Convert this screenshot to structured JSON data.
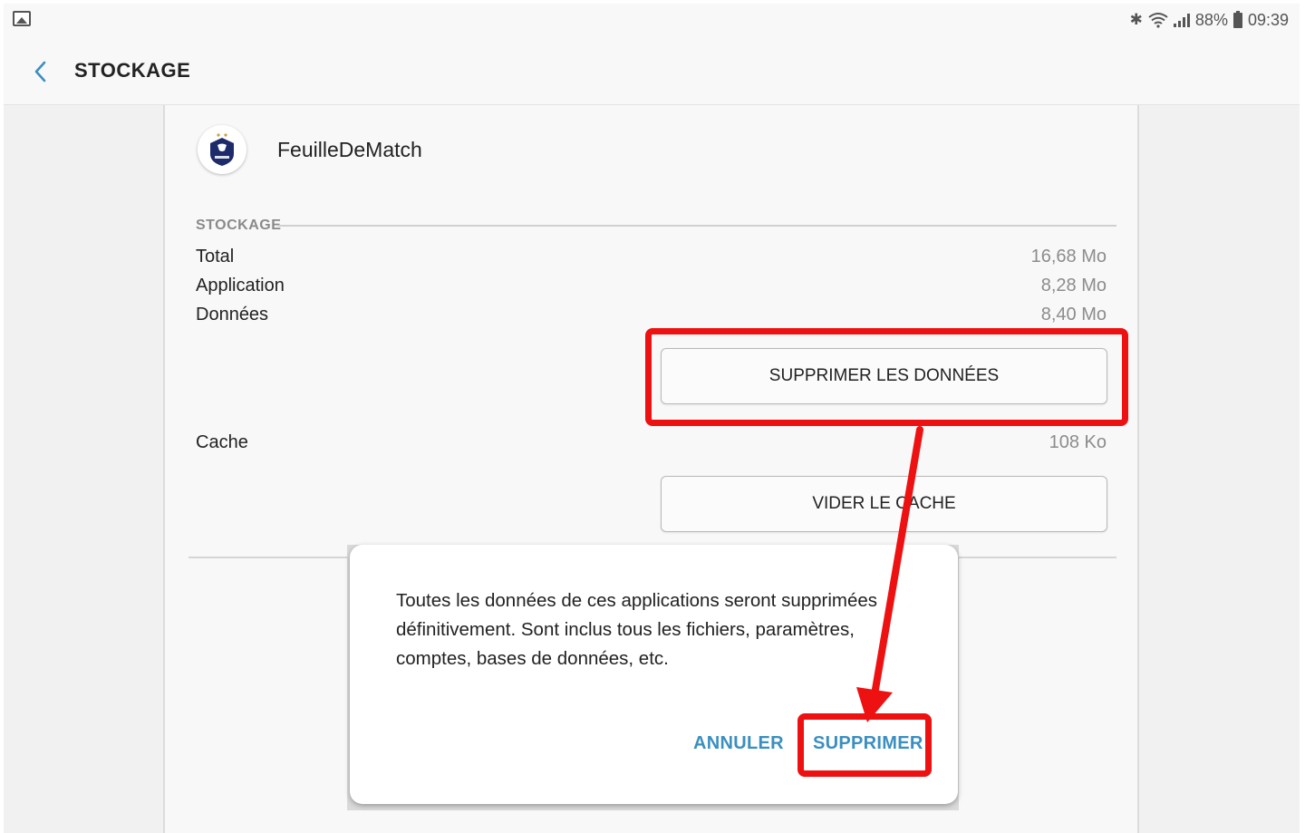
{
  "status_bar": {
    "battery": "88%",
    "time": "09:39",
    "icons": [
      "gallery-icon",
      "bluetooth-icon",
      "wifi-icon",
      "signal-icon",
      "battery-icon"
    ]
  },
  "app_bar": {
    "title": "STOCKAGE",
    "back_icon": "chevron-left-icon"
  },
  "app": {
    "name": "FeuilleDeMatch",
    "icon": "fff-logo-icon"
  },
  "storage": {
    "section_title": "STOCKAGE",
    "rows": [
      {
        "label": "Total",
        "value": "16,68 Mo"
      },
      {
        "label": "Application",
        "value": "8,28 Mo"
      },
      {
        "label": "Données",
        "value": "8,40 Mo"
      }
    ],
    "clear_data_button": "SUPPRIMER LES DONNÉES",
    "cache": {
      "label": "Cache",
      "value": "108 Ko"
    },
    "clear_cache_button": "VIDER LE CACHE"
  },
  "dialog": {
    "message": "Toutes les données de ces applications seront supprimées définitivement. Sont inclus tous les fichiers, paramètres, comptes, bases de données, etc.",
    "cancel_label": "ANNULER",
    "confirm_label": "SUPPRIMER"
  },
  "colors": {
    "accent": "#3a8fc0",
    "highlight": "#ee1111",
    "background": "#f1f1f1"
  }
}
